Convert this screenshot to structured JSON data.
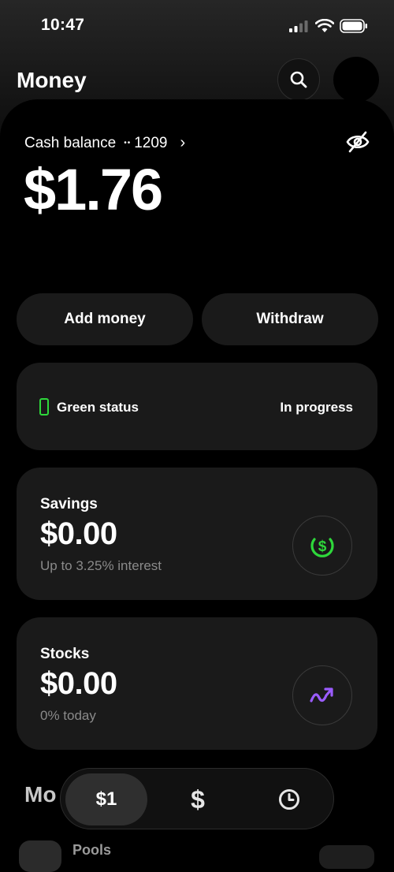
{
  "status_bar": {
    "time": "10:47"
  },
  "header": {
    "title": "Money"
  },
  "balance": {
    "label": "Cash balance",
    "account_mask": "••",
    "account_last4": "1209",
    "amount": "$1.76"
  },
  "actions": {
    "add_money": "Add money",
    "withdraw": "Withdraw"
  },
  "status_card": {
    "label": "Green status",
    "value": "In progress"
  },
  "savings": {
    "title": "Savings",
    "amount": "$0.00",
    "subtitle": "Up to 3.25% interest",
    "icon": "dollar-circle-icon",
    "icon_color": "#2ed83b"
  },
  "stocks": {
    "title": "Stocks",
    "amount": "$0.00",
    "subtitle": "0% today",
    "icon": "trend-up-icon",
    "icon_color": "#9b5cff"
  },
  "section_peek": {
    "title": "Mo",
    "pools_label": "Pools"
  },
  "tab_bar": {
    "money_label": "$1",
    "cash_label": "$",
    "activity_icon": "clock-icon"
  },
  "colors": {
    "accent_green": "#2ed83b",
    "accent_purple": "#9b5cff",
    "card_bg": "#1a1a1a"
  }
}
